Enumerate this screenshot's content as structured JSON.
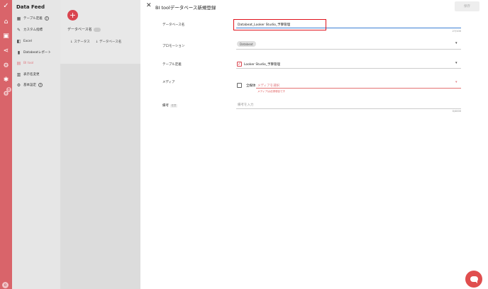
{
  "rail": {
    "icons": [
      "logo-icon",
      "home-icon",
      "table-icon",
      "share-icon",
      "settings-icon",
      "run-icon",
      "user-settings-icon"
    ],
    "badge": "8",
    "avatar": "o"
  },
  "sidebar": {
    "title": "Data Feed",
    "collapse_icon": "chevron-left-icon",
    "items": [
      {
        "label": "テーブル定義",
        "icon": "table-icon",
        "help": "?"
      },
      {
        "label": "カスタム指標",
        "icon": "wrench-icon"
      },
      {
        "label": "Excel",
        "icon": "excel-icon"
      },
      {
        "label": "Databeatレポート",
        "icon": "bar-chart-icon"
      },
      {
        "label": "BI tool",
        "icon": "database-icon",
        "active": true
      },
      {
        "label": "表示名変更",
        "icon": "rename-icon"
      },
      {
        "label": "基本設定",
        "icon": "gear-icon",
        "help": "?"
      }
    ]
  },
  "list_panel": {
    "add_label": "+",
    "title": "データベース名",
    "columns": [
      "ステータス",
      "データベース名"
    ],
    "sort_icon": "↓"
  },
  "dialog": {
    "title": "BI toolデータベース新規登録",
    "save_label": "保存",
    "fields": {
      "database_name": {
        "label": "データベース名",
        "value": "Databeat_Looker Studio_予算管理",
        "counter": "27/100"
      },
      "promotion": {
        "label": "プロモーション",
        "chip": "Databeat"
      },
      "table_def": {
        "label": "テーブル定義",
        "value": "Looker Studio_予算管理"
      },
      "media": {
        "label": "メディア",
        "checkbox_label": "全媒体",
        "placeholder": "メディアを選択",
        "error": "メディアは必須項目です"
      },
      "note": {
        "label": "備考",
        "optional_tag": "任意",
        "placeholder": "備考を入力",
        "counter": "0/4000"
      }
    }
  },
  "colors": {
    "brand": "#d9646a",
    "accent_red": "#d9454f",
    "focus_blue": "#3b7fd4",
    "highlight": "#e0121c"
  }
}
